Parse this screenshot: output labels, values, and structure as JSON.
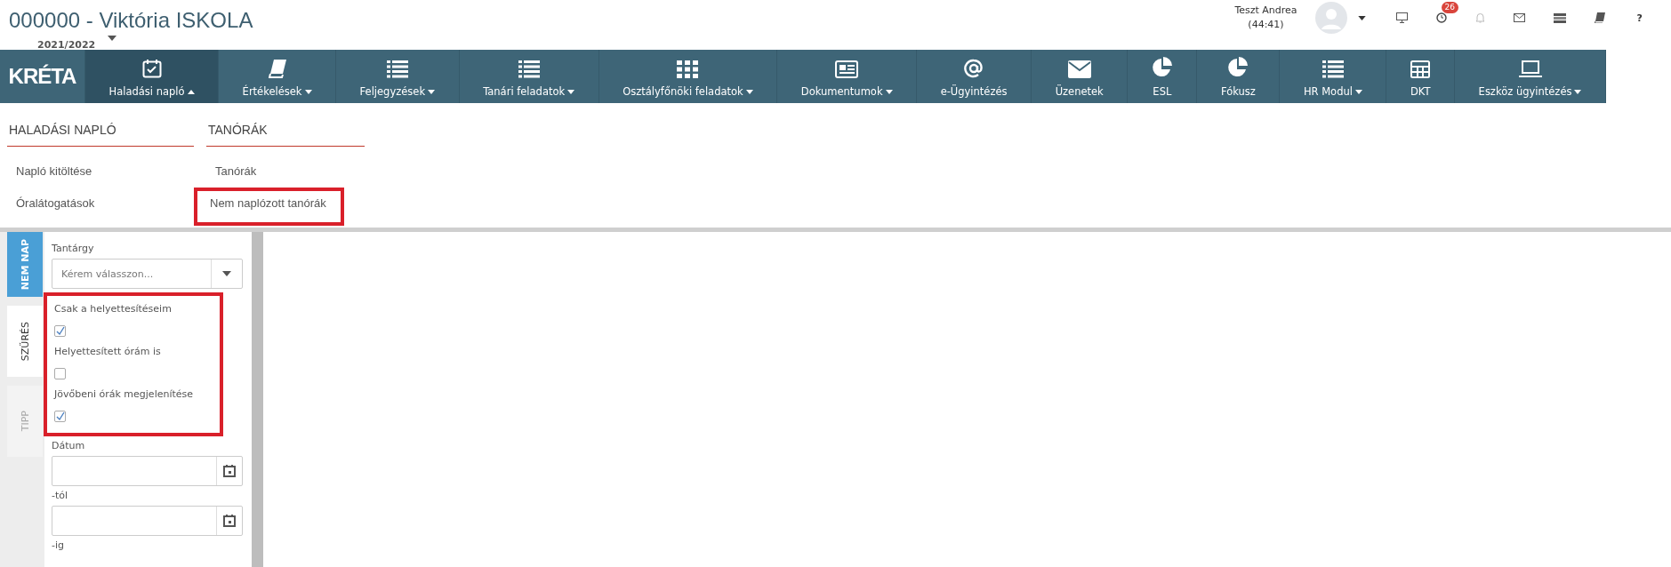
{
  "header": {
    "title": "000000 - Viktória ISKOLA",
    "school_year": "2021/2022",
    "user_name": "Teszt Andrea",
    "session_time": "(44:41)",
    "notification_count": "26",
    "help_label": "?"
  },
  "nav": {
    "logo": "KRÉTA",
    "items": [
      {
        "label": "Haladási napló",
        "kind": "calendar",
        "dropdown": true,
        "selected": true
      },
      {
        "label": "Értékelések",
        "kind": "book",
        "dropdown": true,
        "selected": false
      },
      {
        "label": "Feljegyzések",
        "kind": "list",
        "dropdown": true,
        "selected": false
      },
      {
        "label": "Tanári feladatok",
        "kind": "list",
        "dropdown": true,
        "selected": false
      },
      {
        "label": "Osztályfőnöki feladatok",
        "kind": "grid",
        "dropdown": true,
        "selected": false
      },
      {
        "label": "Dokumentumok",
        "kind": "newspaper",
        "dropdown": true,
        "selected": false
      },
      {
        "label": "e-Ügyintézés",
        "kind": "at",
        "dropdown": false,
        "selected": false
      },
      {
        "label": "Üzenetek",
        "kind": "envelope",
        "dropdown": false,
        "selected": false
      },
      {
        "label": "ESL",
        "kind": "pie",
        "dropdown": false,
        "selected": false
      },
      {
        "label": "Fókusz",
        "kind": "pie",
        "dropdown": false,
        "selected": false
      },
      {
        "label": "HR Modul",
        "kind": "list",
        "dropdown": true,
        "selected": false
      },
      {
        "label": "DKT",
        "kind": "table",
        "dropdown": false,
        "selected": false
      },
      {
        "label": "Eszköz ügyintézés",
        "kind": "laptop",
        "dropdown": true,
        "selected": false
      }
    ]
  },
  "menu": {
    "sections": [
      {
        "heading": "HALADÁSI NAPLÓ",
        "items": [
          {
            "label": "Napló kitöltése",
            "highlighted": false
          },
          {
            "label": "Óralátogatások",
            "highlighted": false
          }
        ]
      },
      {
        "heading": "TANÓRÁK",
        "items": [
          {
            "label": "Tanórák",
            "highlighted": false
          },
          {
            "label": "Nem naplózott tanórák",
            "highlighted": true
          }
        ]
      }
    ]
  },
  "sidebar": {
    "tabs": [
      {
        "label": "NEM NAP",
        "selected": true,
        "disabled": false
      },
      {
        "label": "SZŰRÉS",
        "selected": false,
        "disabled": false
      },
      {
        "label": "TIPP",
        "selected": false,
        "disabled": true
      }
    ]
  },
  "filter": {
    "subject_label": "Tantárgy",
    "subject_placeholder": "Kérem válasszon...",
    "checkbox_group_highlighted": true,
    "checkboxes": [
      {
        "label": "Csak a helyettesítéseim",
        "checked": true
      },
      {
        "label": "Helyettesített órám is",
        "checked": false
      },
      {
        "label": "Jövőbeni órák megjelenítése",
        "checked": true
      }
    ],
    "date_fields": [
      {
        "label": "Dátum"
      },
      {
        "label": "-tól"
      },
      {
        "label": "-ig"
      }
    ]
  }
}
